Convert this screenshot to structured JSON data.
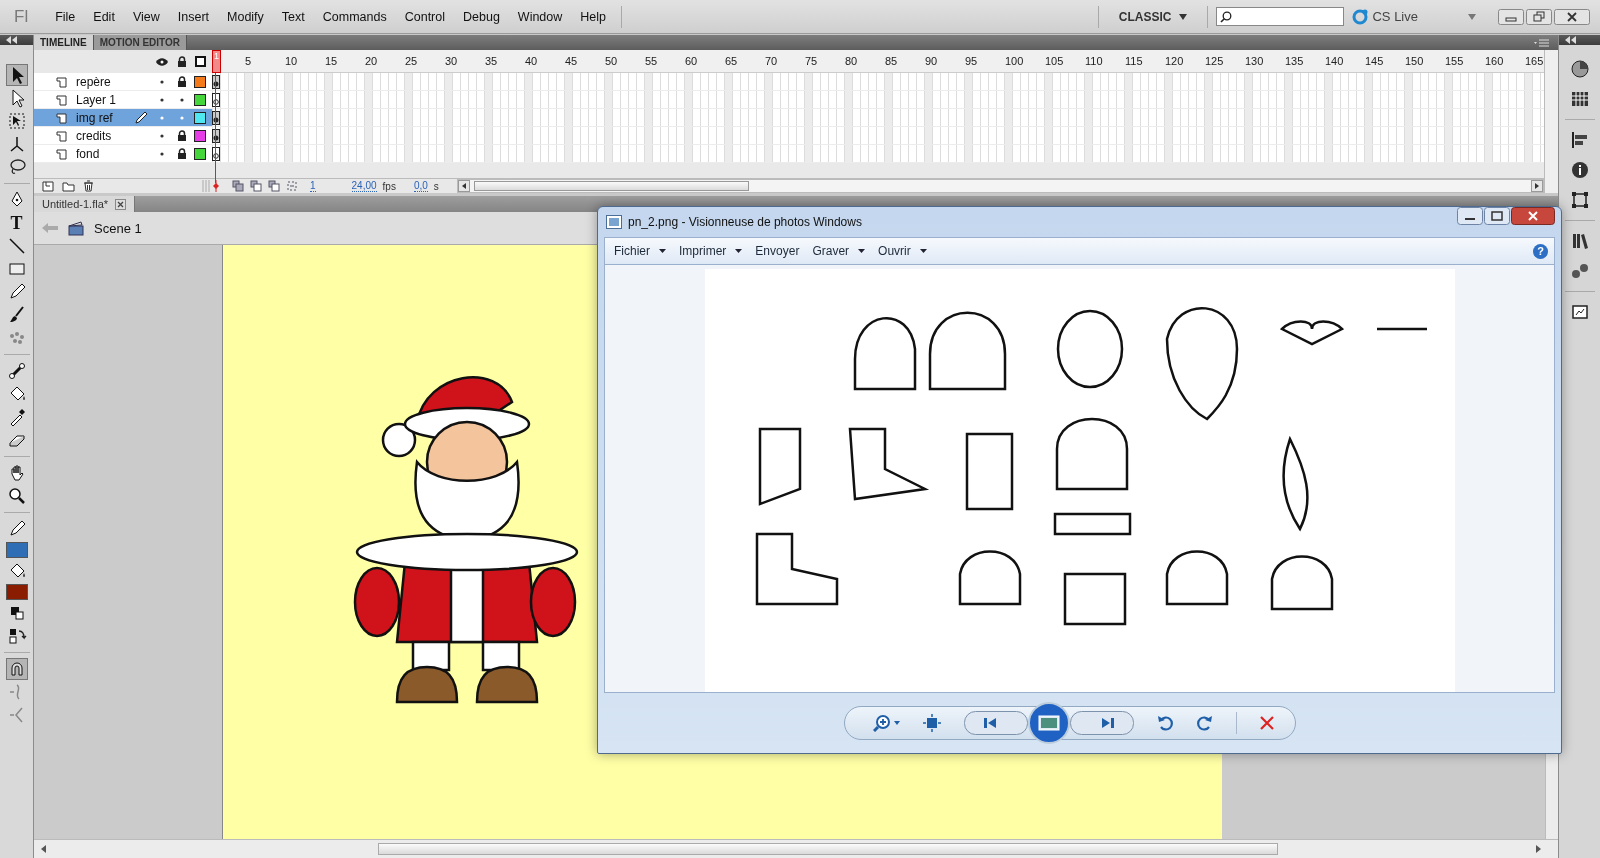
{
  "menubar": {
    "logo": "Fl",
    "items": [
      "File",
      "Edit",
      "View",
      "Insert",
      "Modify",
      "Text",
      "Commands",
      "Control",
      "Debug",
      "Window",
      "Help"
    ],
    "workspace": "CLASSIC",
    "cs_live": "CS Live"
  },
  "toolbar": {
    "text_tool": "T",
    "swatches": [
      {
        "kind": "stroke",
        "color": "#2f6db5"
      },
      {
        "kind": "fill",
        "color": "#8a1c00"
      }
    ]
  },
  "timeline": {
    "tabs": [
      {
        "label": "TIMELINE",
        "selected": true
      },
      {
        "label": "MOTION EDITOR",
        "selected": false
      }
    ],
    "ruler": [
      {
        "label": "1",
        "playhead": true
      },
      {
        "label": "5",
        "playhead": false
      },
      {
        "label": "10",
        "playhead": false
      },
      {
        "label": "15",
        "playhead": false
      },
      {
        "label": "20",
        "playhead": false
      },
      {
        "label": "25",
        "playhead": false
      },
      {
        "label": "30",
        "playhead": false
      },
      {
        "label": "35",
        "playhead": false
      },
      {
        "label": "40",
        "playhead": false
      },
      {
        "label": "45",
        "playhead": false
      },
      {
        "label": "50",
        "playhead": false
      },
      {
        "label": "55",
        "playhead": false
      },
      {
        "label": "60",
        "playhead": false
      },
      {
        "label": "65",
        "playhead": false
      },
      {
        "label": "70",
        "playhead": false
      },
      {
        "label": "75",
        "playhead": false
      },
      {
        "label": "80",
        "playhead": false
      },
      {
        "label": "85",
        "playhead": false
      },
      {
        "label": "90",
        "playhead": false
      },
      {
        "label": "95",
        "playhead": false
      },
      {
        "label": "100",
        "playhead": false
      },
      {
        "label": "105",
        "playhead": false
      },
      {
        "label": "110",
        "playhead": false
      },
      {
        "label": "115",
        "playhead": false
      },
      {
        "label": "120",
        "playhead": false
      },
      {
        "label": "125",
        "playhead": false
      },
      {
        "label": "130",
        "playhead": false
      },
      {
        "label": "135",
        "playhead": false
      },
      {
        "label": "140",
        "playhead": false
      },
      {
        "label": "145",
        "playhead": false
      },
      {
        "label": "150",
        "playhead": false
      },
      {
        "label": "155",
        "playhead": false
      },
      {
        "label": "160",
        "playhead": false
      },
      {
        "label": "165",
        "playhead": false
      }
    ],
    "layers": [
      {
        "name": "repère",
        "selected": false,
        "editing": false,
        "visible": true,
        "locked": true,
        "color": "#f47a1a",
        "keyframe_filled": true
      },
      {
        "name": "Layer 1",
        "selected": false,
        "editing": false,
        "visible": true,
        "locked": false,
        "color": "#45d63b",
        "keyframe_filled": false
      },
      {
        "name": "img ref",
        "selected": true,
        "editing": true,
        "visible": true,
        "locked": false,
        "color": "#4fe8f0",
        "keyframe_filled": true
      },
      {
        "name": "credits",
        "selected": false,
        "editing": false,
        "visible": true,
        "locked": true,
        "color": "#e63de6",
        "keyframe_filled": true
      },
      {
        "name": "fond",
        "selected": false,
        "editing": false,
        "visible": true,
        "locked": true,
        "color": "#45d63b",
        "keyframe_filled": false
      }
    ],
    "footer": {
      "current_frame": "1",
      "frame_rate": "24,00",
      "frame_rate_unit": "fps",
      "elapsed_time": "0,0",
      "elapsed_unit": "s"
    }
  },
  "document": {
    "tab": "Untitled-1.fla*",
    "scene": "Scene 1"
  },
  "photo_viewer": {
    "title": "pn_2.png - Visionneuse de photos Windows",
    "menu": [
      {
        "label": "Fichier",
        "dropdown": true
      },
      {
        "label": "Imprimer",
        "dropdown": true
      },
      {
        "label": "Envoyer",
        "dropdown": false
      },
      {
        "label": "Graver",
        "dropdown": true
      },
      {
        "label": "Ouvrir",
        "dropdown": true
      }
    ],
    "help": "?"
  }
}
